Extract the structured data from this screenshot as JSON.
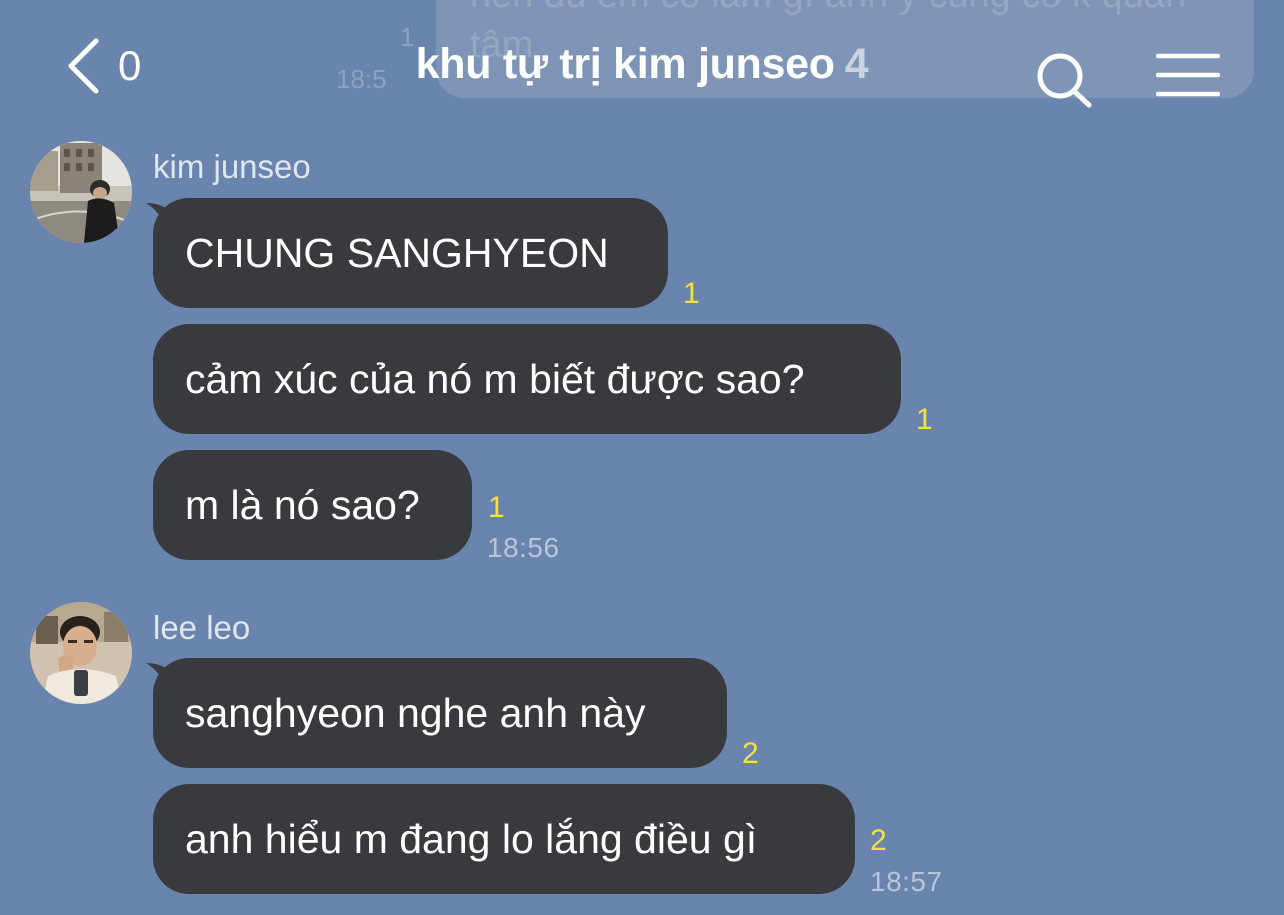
{
  "header": {
    "back_count": "0",
    "title": "khu tự trị kim junseo",
    "member_count": "4"
  },
  "previous_message": {
    "text": "nên dù em có làm gì anh ý cũng có k quan tâm",
    "read_count": "1",
    "time": "18:5"
  },
  "groups": [
    {
      "sender": "kim junseo",
      "messages": [
        {
          "text": "CHUNG SANGHYEON",
          "read": "1"
        },
        {
          "text": "cảm xúc của nó m biết được sao?",
          "read": "1"
        },
        {
          "text": "m là nó sao?",
          "read": "1"
        }
      ],
      "time": "18:56"
    },
    {
      "sender": "lee leo",
      "messages": [
        {
          "text": "sanghyeon nghe anh này",
          "read": "2"
        },
        {
          "text": "anh hiểu m đang lo lắng điều gì",
          "read": "2"
        }
      ],
      "time": "18:57"
    }
  ],
  "colors": {
    "background": "#6984ad",
    "bubble": "#393a3e",
    "read_count": "#f6e23a"
  },
  "icons": {
    "back": "chevron-left-icon",
    "search": "search-icon",
    "menu": "hamburger-menu-icon"
  }
}
